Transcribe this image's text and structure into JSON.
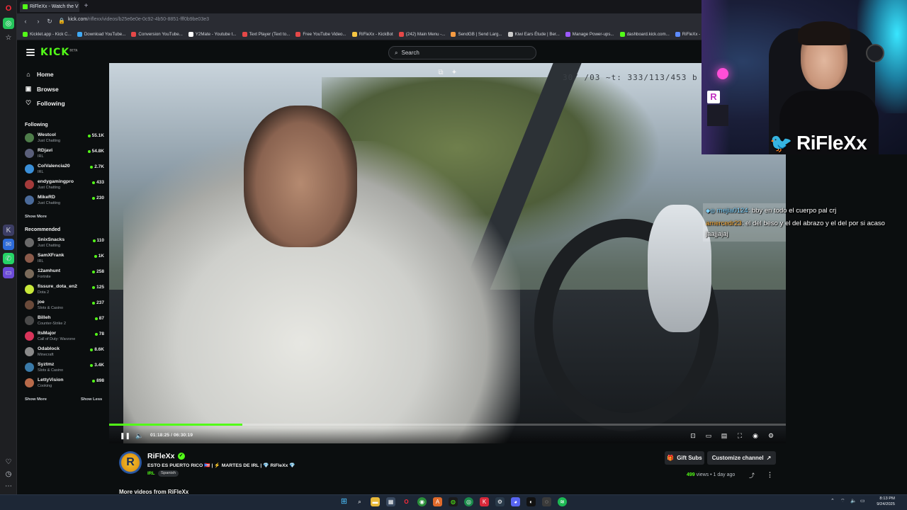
{
  "browser": {
    "tab_title": "RiFleXx - Watch the V",
    "url_host": "kick.com",
    "url_path": "/riflexx/videos/b25e6e0e-0c92-4b50-8851-fff0b9be03e3",
    "bookmarks": [
      {
        "label": "Kicklet.app - Kick C...",
        "color": "#53fc18"
      },
      {
        "label": "Download YouTube...",
        "color": "#3fa9f5"
      },
      {
        "label": "Conversion YouTube...",
        "color": "#e54848"
      },
      {
        "label": "Y2Mate - Youtube t...",
        "color": "#ffffff"
      },
      {
        "label": "Text Player (Text to...",
        "color": "#e54848"
      },
      {
        "label": "Free YouTube Video...",
        "color": "#e54848"
      },
      {
        "label": "RiFleXx - KickBot",
        "color": "#f5c542"
      },
      {
        "label": "(242) Main Menu -...",
        "color": "#e54848"
      },
      {
        "label": "SendGB | Send Larg...",
        "color": "#f59b42"
      },
      {
        "label": "Kiwi Ears Étude | Ber...",
        "color": "#cccccc"
      },
      {
        "label": "Manage Power-ups...",
        "color": "#9b59ff"
      },
      {
        "label": "dashboard.kick.com...",
        "color": "#53fc18"
      },
      {
        "label": "RiFleXx - Triggerfyre",
        "color": "#5d8bff"
      }
    ]
  },
  "kick": {
    "logo": "KICK",
    "logo_tag": "BETA",
    "search_placeholder": "Search",
    "nav": [
      {
        "label": "Home",
        "icon": "home-icon",
        "glyph": "⌂"
      },
      {
        "label": "Browse",
        "icon": "browse-icon",
        "glyph": "▣"
      },
      {
        "label": "Following",
        "icon": "heart-icon",
        "glyph": "♡"
      }
    ],
    "following_title": "Following",
    "following": [
      {
        "name": "Westcol",
        "category": "Just Chatting",
        "viewers": "55.1K",
        "color": "#4e7d4a"
      },
      {
        "name": "RDjavi",
        "category": "IRL",
        "viewers": "54.8K",
        "color": "#5a5f7a"
      },
      {
        "name": "ColValencia20",
        "category": "IRL",
        "viewers": "2.7K",
        "color": "#3a8fd8"
      },
      {
        "name": "endygamingpro",
        "category": "Just Chatting",
        "viewers": "433",
        "color": "#a33a3a"
      },
      {
        "name": "MikeRD",
        "category": "Just Chatting",
        "viewers": "230",
        "color": "#4a6a9a"
      }
    ],
    "show_more": "Show More",
    "recommended_title": "Recommended",
    "recommended": [
      {
        "name": "SnixSnacks",
        "category": "Just Chatting",
        "viewers": "110",
        "color": "#6a6a6a"
      },
      {
        "name": "SamXFrank",
        "category": "IRL",
        "viewers": "1K",
        "color": "#8a5a4a"
      },
      {
        "name": "12amhunt",
        "category": "Fortnite",
        "viewers": "258",
        "color": "#7a6a5a"
      },
      {
        "name": "fissure_dota_en2",
        "category": "Dota 2",
        "viewers": "125",
        "color": "#c8e83a"
      },
      {
        "name": "joe",
        "category": "Slots & Casino",
        "viewers": "237",
        "color": "#6a4a3a"
      },
      {
        "name": "Billeh",
        "category": "Counter-Strike 2",
        "viewers": "87",
        "color": "#4a4a4a"
      },
      {
        "name": "ItsMajor",
        "category": "Call of Duty: Warzone",
        "viewers": "78",
        "color": "#d8345a"
      },
      {
        "name": "Odablock",
        "category": "Minecraft",
        "viewers": "8.6K",
        "color": "#8a8a8a"
      },
      {
        "name": "Syztmz",
        "category": "Slots & Casino",
        "viewers": "3.4K",
        "color": "#3a7aa8"
      },
      {
        "name": "LettyVision",
        "category": "Cooking",
        "viewers": "898",
        "color": "#b86a4a"
      }
    ],
    "show_less": "Show Less"
  },
  "video": {
    "hud_text": "30/ /03 ~t: 333/113/453 b",
    "progress": 0.197,
    "timecode": "01:18:25 / 06:30:19",
    "chat": [
      {
        "user": "mejia0124",
        "text": ": bby en todo el cuerpo pal crj"
      },
      {
        "user": "amercedr23",
        "text": ": el del beso y el del abrazo y el del por si acaso"
      },
      {
        "user": "",
        "text": "jaajjajaj"
      }
    ]
  },
  "webcam": {
    "handle": "RiFleXx",
    "room_logo": "R"
  },
  "channel": {
    "name": "RiFleXx",
    "avatar_letter": "R",
    "title": "ESTO ES PUERTO RICO 🇵🇷 | ⚡ MARTES DE IRL | 💎 RiFleXx 💎",
    "category": "IRL",
    "language": "Spanish",
    "gift_subs": "Gift Subs",
    "customize": "Customize channel",
    "views_count": "499",
    "views_suffix": "views",
    "date": "1 day ago",
    "more_videos": "More videos from RiFleXx"
  },
  "taskbar": {
    "time": "8:13 PM",
    "date": "9/24/2025"
  }
}
